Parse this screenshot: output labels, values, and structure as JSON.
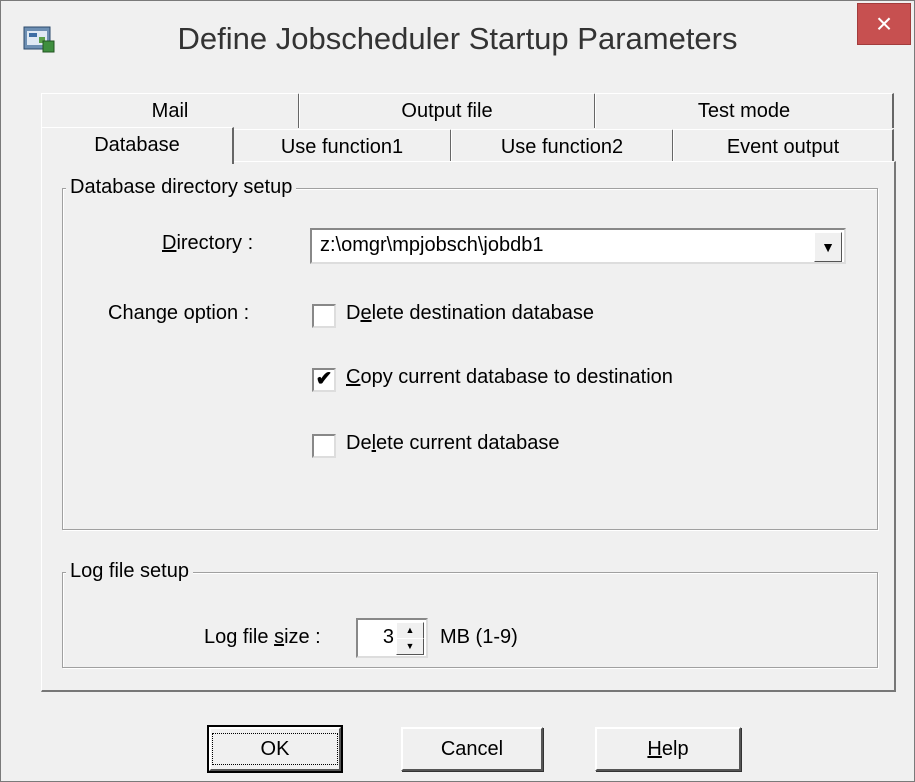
{
  "window": {
    "title": "Define Jobscheduler Startup Parameters",
    "close_label": "×"
  },
  "tabs": {
    "back_row": [
      {
        "label": "Mail"
      },
      {
        "label": "Output file"
      },
      {
        "label": "Test mode"
      }
    ],
    "front_row": [
      {
        "label": "Database",
        "active": true
      },
      {
        "label": "Use function1"
      },
      {
        "label": "Use function2"
      },
      {
        "label": "Event output"
      }
    ]
  },
  "database_group": {
    "legend": "Database directory setup",
    "directory_label_pre": "",
    "directory_label_u": "D",
    "directory_label_post": "irectory :",
    "directory_value": "z:\\omgr\\mpjobsch\\jobdb1",
    "change_option_label": "Change option :",
    "options": [
      {
        "pre": "D",
        "u": "e",
        "post": "lete destination database",
        "checked": false
      },
      {
        "pre": "",
        "u": "C",
        "post": "opy current database to destination",
        "checked": true
      },
      {
        "pre": "De",
        "u": "l",
        "post": "ete current database",
        "checked": false
      }
    ]
  },
  "log_group": {
    "legend": "Log file setup",
    "size_label_pre": "Log file ",
    "size_label_u": "s",
    "size_label_post": "ize :",
    "size_value": "3",
    "size_unit": "MB (1-9)"
  },
  "buttons": {
    "ok": "OK",
    "cancel": "Cancel",
    "help_u": "H",
    "help_post": "elp"
  },
  "colors": {
    "close_button": "#c75050",
    "dialog_bg": "#f0f0f0"
  }
}
